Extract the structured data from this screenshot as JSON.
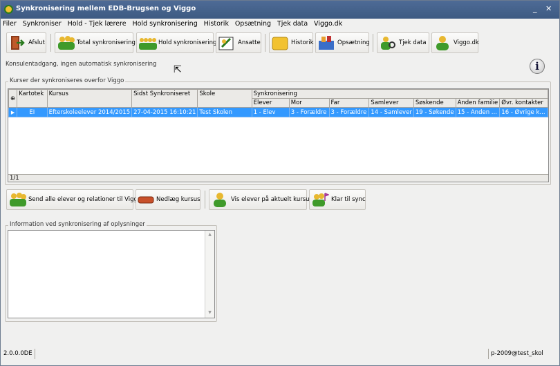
{
  "window": {
    "title": "Synkronisering mellem EDB-Brugsen og Viggo",
    "minimize": "_",
    "close": "✕"
  },
  "menu": [
    "Filer",
    "Synkroniser",
    "Hold - Tjek lærere",
    "Hold synkronisering",
    "Historik",
    "Opsætning",
    "Tjek data",
    "Viggo.dk"
  ],
  "toolbar": {
    "afslut": "Afslut",
    "total_sync": "Total synkronisering",
    "hold_sync": "Hold synkronisering",
    "ansatte": "Ansatte",
    "historik": "Historik",
    "opsaetning": "Opsætning",
    "tjek_data": "Tjek data",
    "viggo": "Viggo.dk"
  },
  "status_message": "Konsulentadgang, ingen automatisk synkronisering",
  "info_icon_text": "i",
  "courses_group": {
    "label": "Kurser der synkroniseres overfor Viggo",
    "columns": [
      "Kartotek",
      "Kursus",
      "Sidst Synkroniseret",
      "Skole"
    ],
    "sync_group_header": "Synkronisering",
    "sync_columns": [
      "Elever",
      "Mor",
      "Far",
      "Samlever",
      "Søskende",
      "Anden familie",
      "Øvr. kontakter"
    ],
    "rows": [
      {
        "cells": [
          "EI",
          "Efterskoleelever 2014/2015",
          "27-04-2015 16:10:21",
          "Test Skolen",
          "1 - Elev",
          "3 - Forældre",
          "3 - Forældre",
          "14 - Samlever",
          "19 - Søkende",
          "15 - Anden ...",
          "16 - Øvrige k..."
        ]
      }
    ],
    "pager": "1/1"
  },
  "actions": {
    "send_all": "Send alle elever og relationer til Viggo",
    "nedlaeg": "Nedlæg kursus",
    "vis_elever": "Vis elever på aktuelt kursus",
    "klar": "Klar til sync"
  },
  "info_group": {
    "label": "Information ved synkronisering af oplysninger"
  },
  "statusbar": {
    "version": "2.0.0.0DE",
    "user": "p-2009@test_skol"
  },
  "colors": {
    "titlebar": "#4e6b96",
    "selection": "#3399ff",
    "accent_green": "#2a7a1e"
  }
}
